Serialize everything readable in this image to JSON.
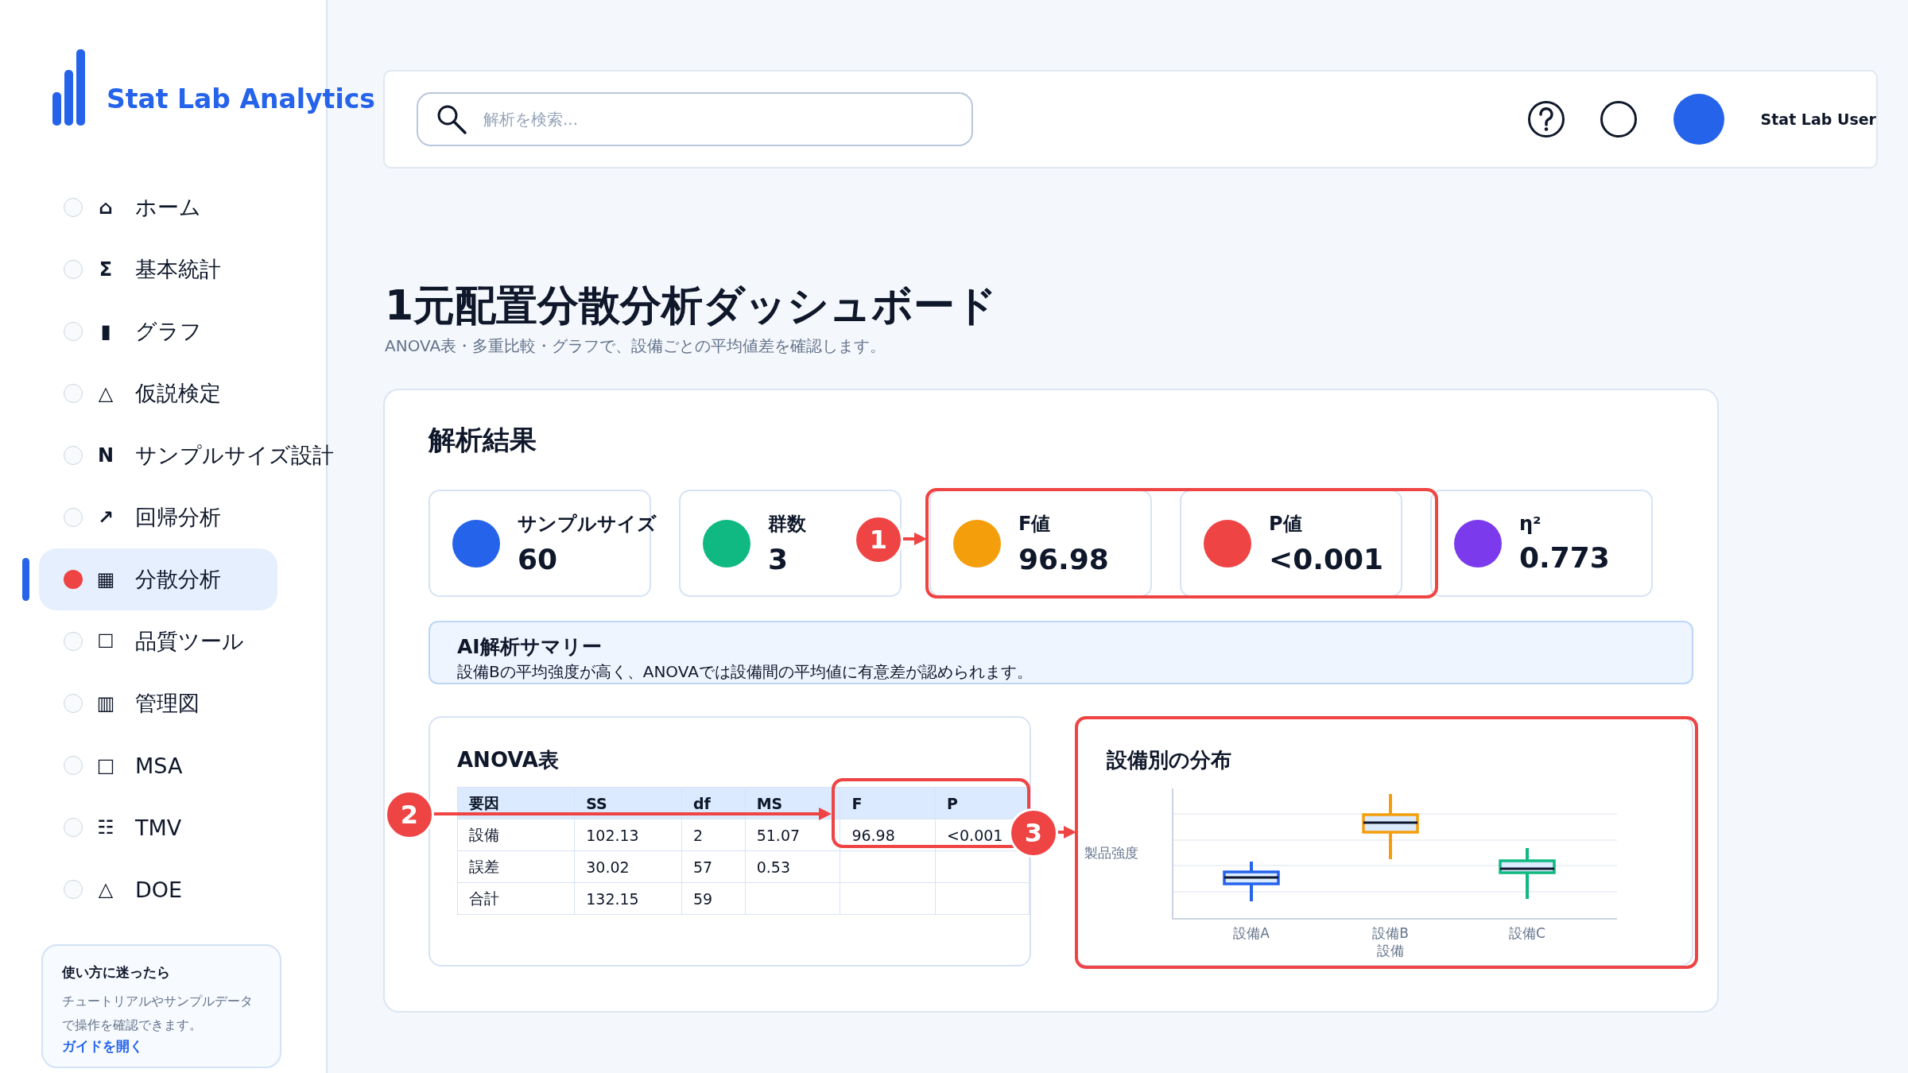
{
  "sidebar": {
    "brand": "Stat Lab Analytics",
    "items": [
      {
        "icon": "⌂",
        "label": "ホーム",
        "selected": false
      },
      {
        "icon": "Σ",
        "label": "基本統計",
        "selected": false
      },
      {
        "icon": "▮",
        "label": "グラフ",
        "selected": false
      },
      {
        "icon": "△",
        "label": "仮説検定",
        "selected": false
      },
      {
        "icon": "N",
        "label": "サンプルサイズ設計",
        "selected": false
      },
      {
        "icon": "↗",
        "label": "回帰分析",
        "selected": false
      },
      {
        "icon": "▦",
        "label": "分散分析",
        "selected": true
      },
      {
        "icon": "☐",
        "label": "品質ツール",
        "selected": false
      },
      {
        "icon": "▥",
        "label": "管理図",
        "selected": false
      },
      {
        "icon": "□",
        "label": "MSA",
        "selected": false
      },
      {
        "icon": "☷",
        "label": "TMV",
        "selected": false
      },
      {
        "icon": "△",
        "label": "DOE",
        "selected": false
      }
    ],
    "help": {
      "title": "使い方に迷ったら",
      "text": "チュートリアルやサンプルデータで操作を確認できます。",
      "link": "ガイドを開く"
    }
  },
  "header": {
    "search": {
      "placeholder": "解析を検索..."
    },
    "user": "Stat Lab User"
  },
  "page": {
    "title": "1元配置分散分析ダッシュボード",
    "subtitle": "ANOVA表・多重比較・グラフで、設備ごとの平均値差を確認します。"
  },
  "results": {
    "title": "解析結果",
    "stats": [
      {
        "label": "サンプルサイズ",
        "value": "60",
        "color": "#2563eb"
      },
      {
        "label": "群数",
        "value": "3",
        "color": "#10b981"
      },
      {
        "label": "F値",
        "value": "96.98",
        "color": "#f59e0b"
      },
      {
        "label": "P値",
        "value": "<0.001",
        "color": "#ef4444"
      },
      {
        "label": "η²",
        "value": "0.773",
        "color": "#7c3aed"
      }
    ],
    "summary": {
      "title": "AI解析サマリー",
      "text": "設備Bの平均強度が高く、ANOVAでは設備間の平均値に有意差が認められます。"
    },
    "anova": {
      "title": "ANOVA表",
      "columns": [
        "要因",
        "SS",
        "df",
        "MS",
        "F",
        "P"
      ],
      "rows": [
        [
          "設備",
          "102.13",
          "2",
          "51.07",
          "96.98",
          "<0.001"
        ],
        [
          "誤差",
          "30.02",
          "57",
          "0.53"
        ],
        [
          "合計",
          "132.15",
          "59"
        ]
      ]
    },
    "distribution": {
      "title": "設備別の分布",
      "ylabel": "製品強度",
      "xlabel": "設備",
      "groups": [
        {
          "label": "設備A",
          "color": "#2563eb"
        },
        {
          "label": "設備B",
          "color": "#f59e0b"
        },
        {
          "label": "設備C",
          "color": "#10b981"
        }
      ]
    },
    "callouts": [
      {
        "label": "1"
      },
      {
        "label": "2"
      },
      {
        "label": "3"
      }
    ]
  }
}
